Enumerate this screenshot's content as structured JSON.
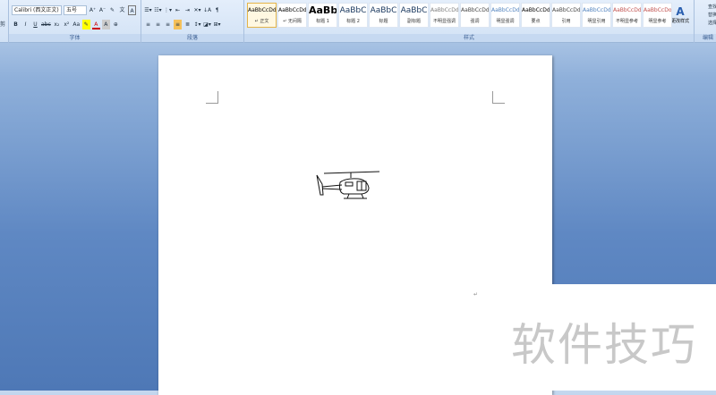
{
  "font_group": {
    "font_name": "Calibri (西文正文)",
    "font_size": "五号",
    "label": "字体",
    "buttons": [
      "B",
      "I",
      "U",
      "abc",
      "x₂",
      "x²",
      "Aa",
      "A"
    ]
  },
  "paragraph_group": {
    "label": "段落"
  },
  "styles_group": {
    "label": "样式",
    "items": [
      {
        "preview": "AaBbCcDd",
        "name": "↵ 正文"
      },
      {
        "preview": "AaBbCcDd",
        "name": "↵ 无间隔"
      },
      {
        "preview": "AaBb",
        "name": "标题 1"
      },
      {
        "preview": "AaBbC",
        "name": "标题 2"
      },
      {
        "preview": "AaBbC",
        "name": "标题"
      },
      {
        "preview": "AaBbC",
        "name": "副标题"
      },
      {
        "preview": "AaBbCcDd",
        "name": "不明显强调"
      },
      {
        "preview": "AaBbCcDd",
        "name": "强调"
      },
      {
        "preview": "AaBbCcDd",
        "name": "明显强调"
      },
      {
        "preview": "AaBbCcDd",
        "name": "要点"
      },
      {
        "preview": "AaBbCcDd",
        "name": "引用"
      },
      {
        "preview": "AaBbCcDd",
        "name": "明显引用"
      },
      {
        "preview": "AaBbCcDd",
        "name": "不明显参考"
      },
      {
        "preview": "AaBbCcDo",
        "name": "明显参考"
      }
    ],
    "change_styles": "更改样式"
  },
  "editing_group": {
    "label": "编辑",
    "find": "查找",
    "replace": "替换",
    "select": "选择"
  },
  "left_stub": "剪",
  "watermark": "软件技巧"
}
